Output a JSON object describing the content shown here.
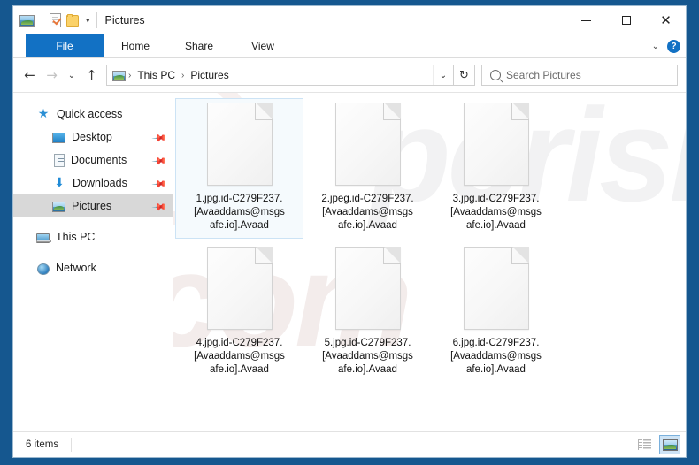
{
  "window": {
    "title": "Pictures",
    "quick_access_toolbar": [
      {
        "name": "pictures-icon",
        "label": "Pictures"
      },
      {
        "name": "properties-icon",
        "label": "Properties"
      },
      {
        "name": "new-folder-icon",
        "label": "New folder"
      },
      {
        "name": "customize-caret",
        "label": "▾"
      }
    ],
    "controls": {
      "minimize": "–",
      "maximize": "□",
      "close": "✕"
    }
  },
  "ribbon": {
    "tabs": [
      {
        "label": "File",
        "selected": true
      },
      {
        "label": "Home",
        "selected": false
      },
      {
        "label": "Share",
        "selected": false
      },
      {
        "label": "View",
        "selected": false
      }
    ],
    "collapse_caret": "⌄",
    "help_label": "?"
  },
  "address_bar": {
    "back": "←",
    "forward": "→",
    "recent": "⌄",
    "up": "↑",
    "breadcrumbs": [
      "This PC",
      "Pictures"
    ],
    "separator": "›",
    "dropdown_caret": "⌄",
    "refresh": "↻"
  },
  "search": {
    "placeholder": "Search Pictures",
    "value": ""
  },
  "sidebar": {
    "items": [
      {
        "label": "Quick access",
        "icon": "star-icon",
        "level": "root",
        "pinned": false,
        "selected": false
      },
      {
        "label": "Desktop",
        "icon": "desktop-icon",
        "level": "child",
        "pinned": true,
        "selected": false
      },
      {
        "label": "Documents",
        "icon": "documents-icon",
        "level": "child",
        "pinned": true,
        "selected": false
      },
      {
        "label": "Downloads",
        "icon": "downloads-icon",
        "level": "child",
        "pinned": true,
        "selected": false
      },
      {
        "label": "Pictures",
        "icon": "pictures-icon",
        "level": "child",
        "pinned": true,
        "selected": true
      },
      {
        "label": "This PC",
        "icon": "this-pc-icon",
        "level": "root",
        "pinned": false,
        "selected": false
      },
      {
        "label": "Network",
        "icon": "network-icon",
        "level": "root",
        "pinned": false,
        "selected": false
      }
    ],
    "pin_glyph": "✒"
  },
  "files": [
    {
      "name": "1.jpg.id-C279F237.[Avaaddams@msgsafe.io].Avaad",
      "selected": true
    },
    {
      "name": "2.jpeg.id-C279F237.[Avaaddams@msgsafe.io].Avaad",
      "selected": false
    },
    {
      "name": "3.jpg.id-C279F237.[Avaaddams@msgsafe.io].Avaad",
      "selected": false
    },
    {
      "name": "4.jpg.id-C279F237.[Avaaddams@msgsafe.io].Avaad",
      "selected": false
    },
    {
      "name": "5.jpg.id-C279F237.[Avaaddams@msgsafe.io].Avaad",
      "selected": false
    },
    {
      "name": "6.jpg.id-C279F237.[Avaaddams@msgsafe.io].Avaad",
      "selected": false
    }
  ],
  "status_bar": {
    "item_count": "6 items",
    "views": [
      {
        "name": "details-view-button",
        "active": false
      },
      {
        "name": "large-icons-view-button",
        "active": true
      }
    ]
  },
  "watermark": {
    "text_a": "pcrisk",
    "text_b": "com"
  },
  "colors": {
    "accent": "#1271c4",
    "desktop": "#15578f",
    "selection": "#cce3f5",
    "sidebar_selected": "#d8d8d8"
  }
}
